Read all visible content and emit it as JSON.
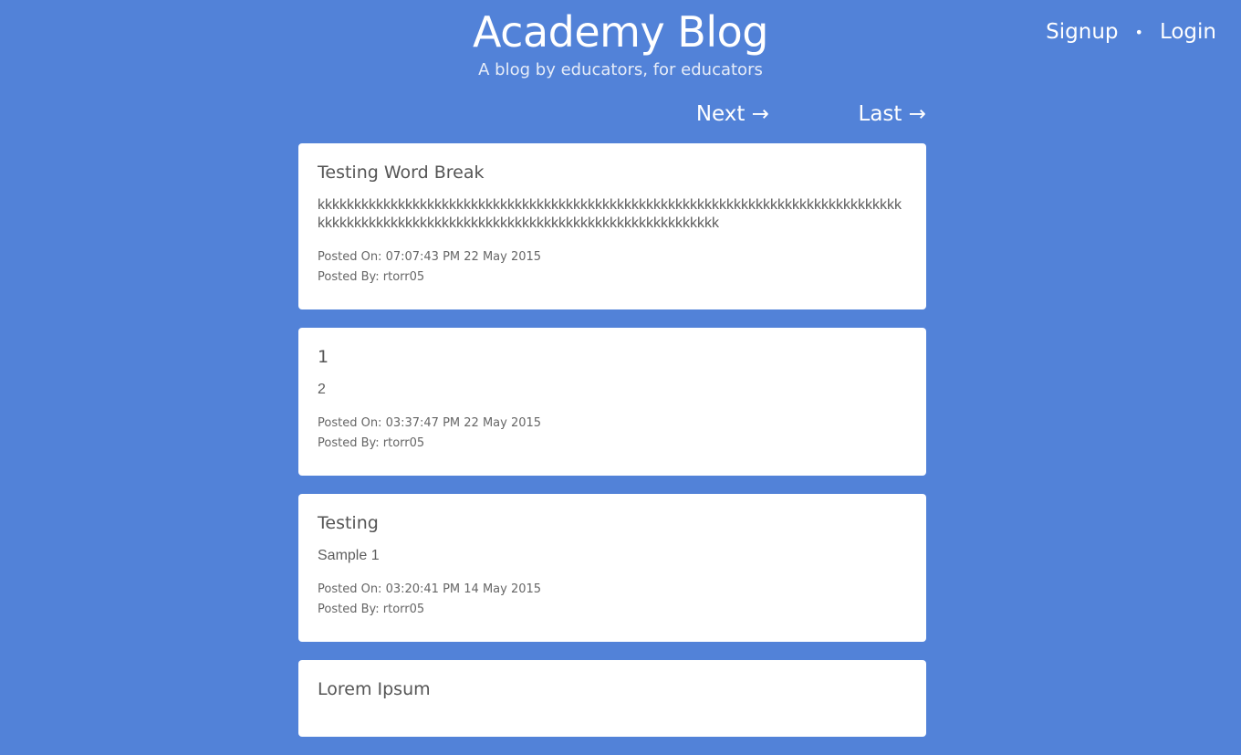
{
  "header": {
    "title": "Academy Blog",
    "subtitle": "A blog by educators, for educators",
    "signup_label": "Signup",
    "separator": "•",
    "login_label": "Login"
  },
  "pager": {
    "next_label": "Next →",
    "last_label": "Last →"
  },
  "posts": [
    {
      "title": "Testing Word Break",
      "body": "kkkkkkkkkkkkkkkkkkkkkkkkkkkkkkkkkkkkkkkkkkkkkkkkkkkkkkkkkkkkkkkkkkkkkkkkkkkkkkkkkkkkkkkkkkkkkkkkkkkkkkkkkkkkkkkkkkkkkkkkkkkkkkkkkkkkkkk",
      "posted_on": "Posted On: 07:07:43 PM 22 May 2015",
      "posted_by": "Posted By: rtorr05"
    },
    {
      "title": "1",
      "body": "2",
      "posted_on": "Posted On: 03:37:47 PM 22 May 2015",
      "posted_by": "Posted By: rtorr05"
    },
    {
      "title": "Testing",
      "body": "Sample 1",
      "posted_on": "Posted On: 03:20:41 PM 14 May 2015",
      "posted_by": "Posted By: rtorr05"
    },
    {
      "title": "Lorem Ipsum",
      "body": "",
      "posted_on": "",
      "posted_by": ""
    }
  ]
}
